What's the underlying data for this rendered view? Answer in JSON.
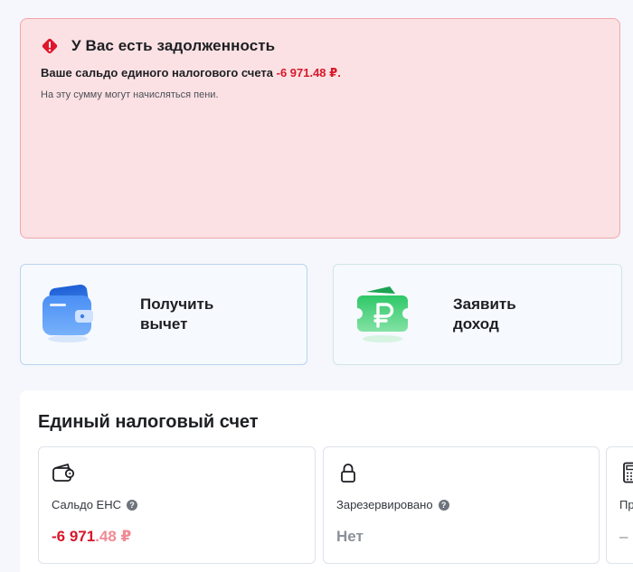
{
  "alert": {
    "title": "У Вас есть задолженность",
    "line_prefix": "Ваше сальдо единого налогового счета",
    "amount": "-6 971.48 ₽.",
    "note": "На эту сумму могут начисляться пени.",
    "icon": "warning-diamond-icon",
    "color": "#d8172b"
  },
  "actions": [
    {
      "label": "Получить вычет",
      "icon": "wallet-card-icon",
      "color": "#3f86f3"
    },
    {
      "label": "Заявить доход",
      "icon": "ruble-ticket-icon",
      "color": "#2fc768"
    }
  ],
  "ens": {
    "title": "Единый налоговый счет",
    "cards": [
      {
        "label": "Сальдо ЕНС",
        "value_int": "-6 971",
        "value_frac": ".48 ₽",
        "icon": "wallet-icon"
      },
      {
        "label": "Зарезервировано",
        "value": "Нет",
        "icon": "lock-icon"
      },
      {
        "label": "Пр",
        "value": "–",
        "icon": "calculator-icon"
      }
    ],
    "help_symbol": "?"
  }
}
